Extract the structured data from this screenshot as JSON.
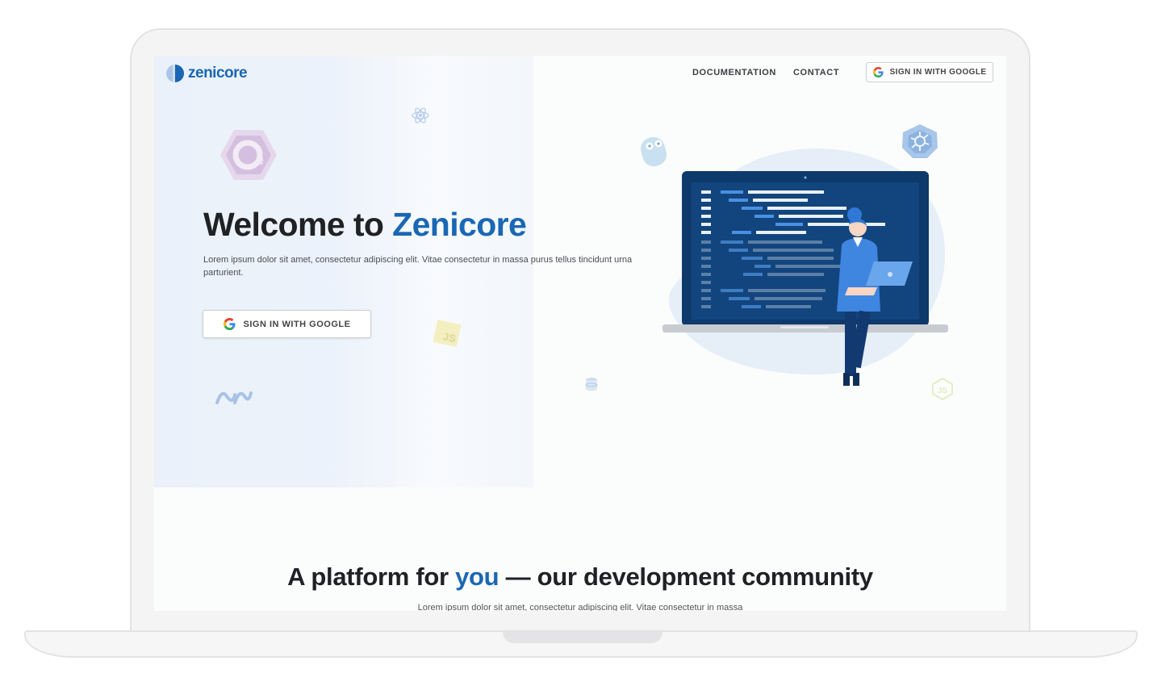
{
  "brand": {
    "name": "zenicore",
    "color": "#1b66b3"
  },
  "nav": {
    "documentation": "DOCUMENTATION",
    "contact": "CONTACT",
    "signin_label": "SIGN IN WITH GOOGLE"
  },
  "hero": {
    "title_prefix": "Welcome to ",
    "title_accent": "Zenicore",
    "description": "Lorem ipsum dolor sit amet, consectetur adipiscing elit. Vitae consectetur in massa purus tellus tincidunt urna parturient.",
    "signin_label": "SIGN IN WITH GOOGLE"
  },
  "decor_labels": {
    "js_badge": "JS"
  },
  "section2": {
    "title_prefix": "A platform for ",
    "title_accent": "you",
    "title_suffix": " — our development community",
    "description": "Lorem ipsum dolor sit amet, consectetur adipiscing elit. Vitae consectetur in massa"
  },
  "icons": [
    "zenicore-logo-icon",
    "google-icon",
    "react-icon",
    "csharp-icon",
    "go-gopher-icon",
    "kubernetes-icon",
    "javascript-icon",
    "dotnet-icon",
    "nodejs-icon",
    "database-icon"
  ],
  "colors": {
    "accent": "#1a67b4",
    "laptop_screen": "#0e3a6b",
    "illustration_blob": "#e6eef8"
  }
}
